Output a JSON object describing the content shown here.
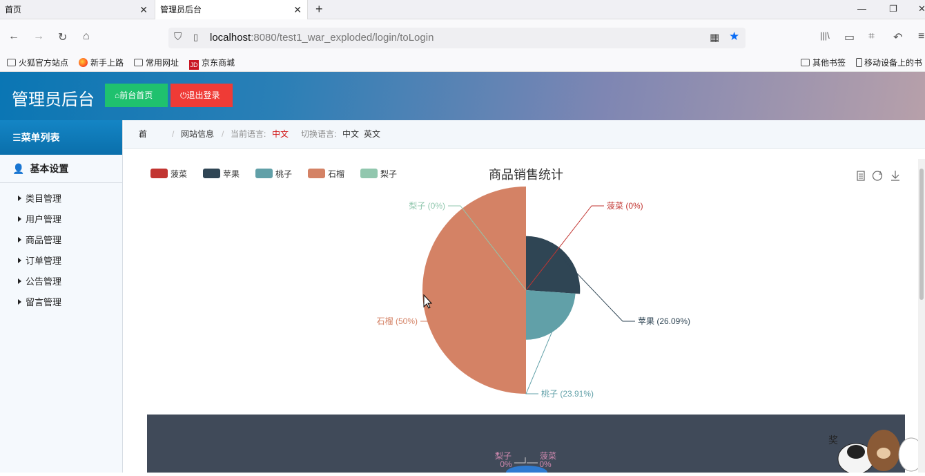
{
  "browser": {
    "tabs": [
      {
        "label": "首页",
        "active": false
      },
      {
        "label": "管理员后台",
        "active": true
      }
    ],
    "url_host": "localhost",
    "url_rest": ":8080/test1_war_exploded/login/toLogin",
    "bookmarks": [
      "火狐官方站点",
      "新手上路",
      "常用网址",
      "京东商城"
    ],
    "bookmarks_right": [
      "其他书签",
      "移动设备上的书"
    ]
  },
  "header": {
    "title": "管理员后台",
    "front_button": "前台首页",
    "logout_button": "退出登录"
  },
  "sidebar": {
    "menu_title": "菜单列表",
    "group": "基本设置",
    "items": [
      "类目管理",
      "用户管理",
      "商品管理",
      "订单管理",
      "公告管理",
      "留言管理"
    ]
  },
  "breadcrumb": {
    "home": "首页",
    "site_info": "网站信息",
    "current_lang_label": "当前语言:",
    "current_lang": "中文",
    "switch_label": "切换语言:",
    "lang_zh": "中文",
    "lang_en": "英文"
  },
  "chart_data": {
    "type": "pie",
    "rose_type": "radius",
    "title": "商品销售统计",
    "legend_position": "top-left",
    "categories": [
      "菠菜",
      "苹果",
      "桃子",
      "石榴",
      "梨子"
    ],
    "values": [
      0,
      26.09,
      23.91,
      50,
      0
    ],
    "labels": [
      "菠菜 (0%)",
      "苹果 (26.09%)",
      "桃子 (23.91%)",
      "石榴 (50%)",
      "梨子 (0%)"
    ],
    "colors": [
      "#c23531",
      "#2f4554",
      "#61a0a8",
      "#d48265",
      "#91c7ae"
    ]
  },
  "second_chart": {
    "labels": [
      {
        "name": "梨子",
        "pct": "0%"
      },
      {
        "name": "菠菜",
        "pct": "0%"
      }
    ]
  }
}
